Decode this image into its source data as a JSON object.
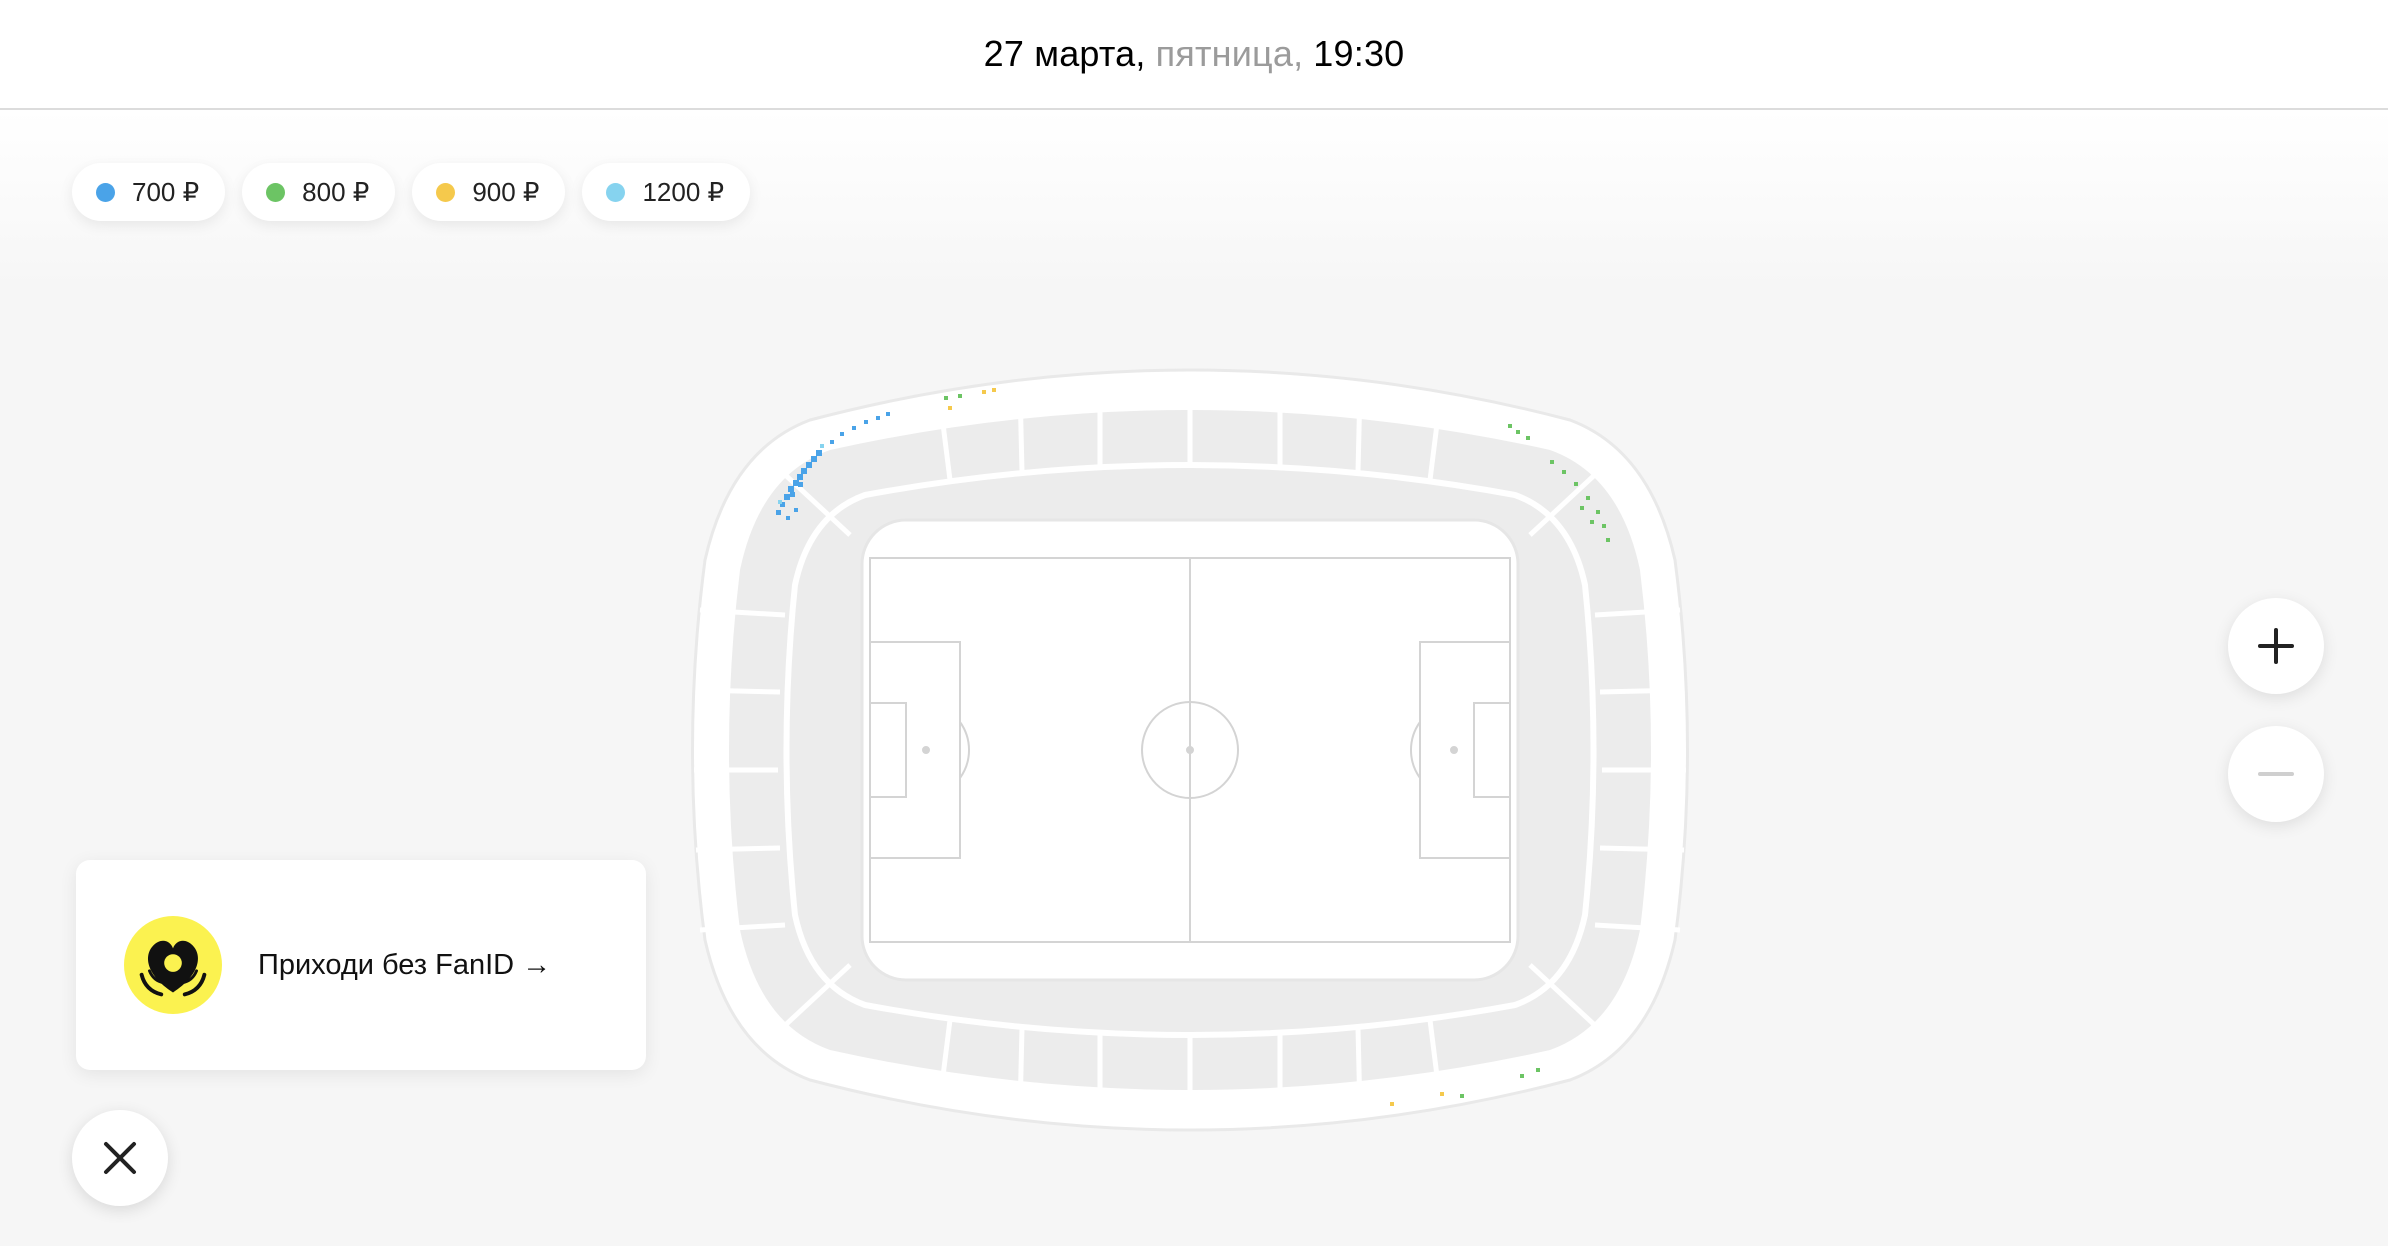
{
  "header": {
    "date": "27 марта,",
    "weekday": "пятница,",
    "time": "19:30"
  },
  "legend": [
    {
      "price": "700 ₽",
      "color": "#4aa3e8"
    },
    {
      "price": "800 ₽",
      "color": "#6cc464"
    },
    {
      "price": "900 ₽",
      "color": "#f5c94c"
    },
    {
      "price": "1200 ₽",
      "color": "#86d3ef"
    }
  ],
  "zoom": {
    "in_icon": "plus-icon",
    "out_icon": "minus-icon"
  },
  "promo": {
    "text": "Приходи без FanID →",
    "icon": "football-heart-logo"
  },
  "close": {
    "icon": "close-icon"
  }
}
